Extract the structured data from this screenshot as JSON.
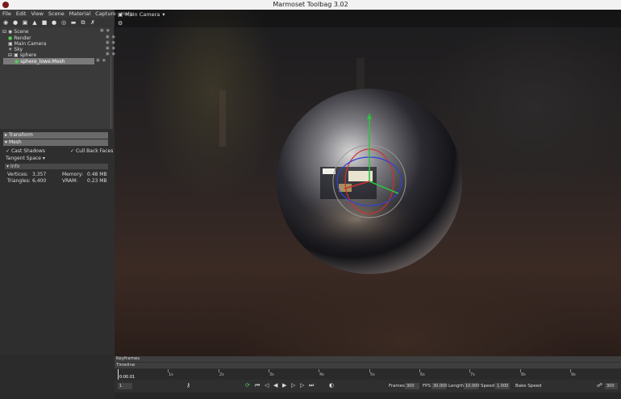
{
  "window": {
    "title": "Marmoset Toolbag 3.02"
  },
  "menu": [
    "File",
    "Edit",
    "View",
    "Scene",
    "Material",
    "Capture",
    "Help"
  ],
  "toolbar_icons": [
    "add-object-icon",
    "light-icon",
    "camera-icon",
    "tree-icon",
    "shader-icon",
    "mesh-icon",
    "material-icon",
    "folder-icon",
    "duplicate-icon",
    "delete-icon"
  ],
  "viewport": {
    "camera_label": "Main Camera"
  },
  "outliner": {
    "items": [
      {
        "label": "Scene",
        "icon": "scene-icon",
        "level": 0
      },
      {
        "label": "Render",
        "icon": "render-icon",
        "level": 1
      },
      {
        "label": "Main Camera",
        "icon": "camera-icon",
        "level": 1
      },
      {
        "label": "Sky",
        "icon": "sky-icon",
        "level": 1
      },
      {
        "label": "sphere",
        "icon": "object-icon",
        "level": 1
      },
      {
        "label": "sphere_lowe:Mesh",
        "icon": "mesh-icon",
        "level": 2,
        "selected": true
      }
    ]
  },
  "properties": {
    "transform_label": "Transform",
    "mesh_label": "Mesh",
    "cast_shadows": "Cast Shadows",
    "cull_back_faces": "Cull Back Faces",
    "tangent_space": "Tangent Space",
    "info_label": "Info",
    "vertices_label": "Vertices:",
    "vertices_value": "3,357",
    "triangles_label": "Triangles:",
    "triangles_value": "6,400",
    "memory_label": "Memory:",
    "memory_value": "0.48 MB",
    "vram_label": "VRAM:",
    "vram_value": "0.23 MB"
  },
  "timeline": {
    "keyframes_label": "Keyframes",
    "timeline_label": "Timeline",
    "current_time": "0:00.01",
    "ticks": [
      "1s",
      "2s",
      "3s",
      "4s",
      "5s",
      "6s",
      "7s",
      "8s",
      "9s"
    ],
    "frame_field": "1",
    "frames_label": "Frames",
    "frames_value": "300",
    "fps_label": "FPS",
    "fps_value": "30.000",
    "length_label": "Length",
    "length_value": "10.000",
    "speed_label": "Speed",
    "speed_value": "1.000",
    "bake_speed_label": "Bake Speed",
    "end_value": "300"
  }
}
